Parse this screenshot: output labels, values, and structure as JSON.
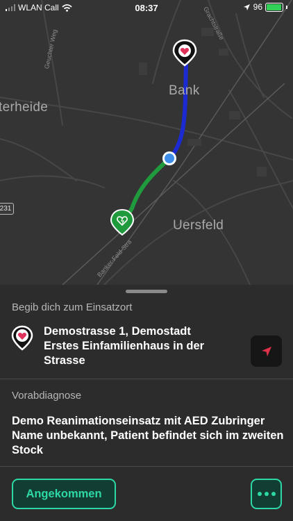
{
  "status_bar": {
    "carrier": "WLAN Call",
    "time": "08:37",
    "battery_percent": "96"
  },
  "map": {
    "places": [
      "Bank",
      "terheide",
      "Uersfeld"
    ],
    "streets": [
      "Gracht­straße",
      "Geuchter Weg",
      "Banker-Feld-Stra"
    ],
    "road_number": "231"
  },
  "sheet": {
    "destination_title": "Begib dich zum Einsatzort",
    "address": "Demostrasse 1, Demostadt Erstes Einfamilienhaus in der Strasse",
    "diagnosis_title": "Vorabdiagnose",
    "diagnosis": "Demo Reanimationseinsatz mit AED Zubringer Name unbekannt, Patient befindet sich im zweiten Stock",
    "arrived_label": "Angekommen"
  },
  "colors": {
    "accent": "#2ed8a6",
    "route_to_destination": "#1b2bd1",
    "route_from_aed": "#1f9a3c",
    "user_location": "#3f8fe8"
  }
}
